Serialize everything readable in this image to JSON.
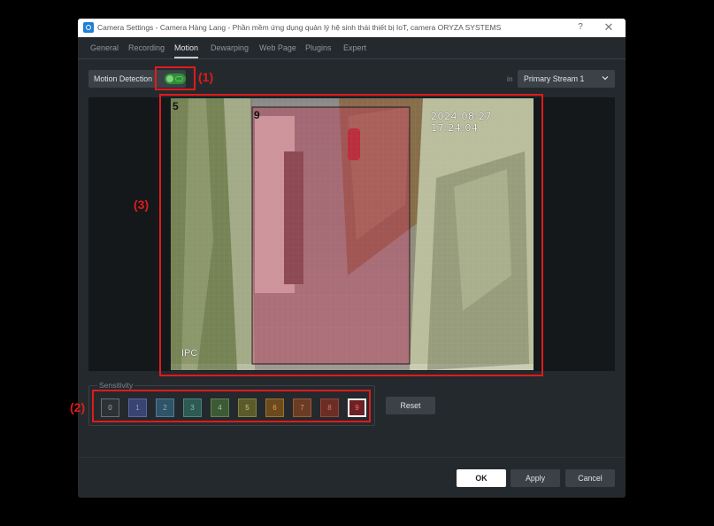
{
  "window": {
    "title": "Camera Settings - Camera Hàng Lang - Phần mềm ứng dụng quản lý hệ sinh thái thiết bị IoT, camera ORYZA SYSTEMS",
    "help_glyph": "?",
    "close_glyph": "✕"
  },
  "tabs": [
    {
      "label": "General",
      "active": false
    },
    {
      "label": "Recording",
      "active": false
    },
    {
      "label": "Motion",
      "active": true
    },
    {
      "label": "Dewarping",
      "active": false
    },
    {
      "label": "Web Page",
      "active": false
    },
    {
      "label": "Plugins",
      "active": false
    },
    {
      "label": "Expert",
      "active": false
    }
  ],
  "motion": {
    "label": "Motion Detection",
    "enabled": true,
    "stream_prefix": "in",
    "stream_value": "Primary Stream 1"
  },
  "video": {
    "timestamp": "2024-08-27 17:24:04",
    "osd_label": "IPC",
    "region_label_left": "5",
    "region_label_center": "9"
  },
  "sensitivity": {
    "legend": "Sensitivity",
    "levels": [
      {
        "label": "0",
        "bg": "#2c3236",
        "border": "#687076",
        "color": "#a9b0b5"
      },
      {
        "label": "1",
        "bg": "#3a4470",
        "border": "#5a66a0",
        "color": "#8f9ad0"
      },
      {
        "label": "2",
        "bg": "#2f5468",
        "border": "#4f7c95",
        "color": "#7fb0c8"
      },
      {
        "label": "3",
        "bg": "#2d5a52",
        "border": "#4a857a",
        "color": "#7cc0b0"
      },
      {
        "label": "4",
        "bg": "#3d5a36",
        "border": "#5e8252",
        "color": "#9cc88c"
      },
      {
        "label": "5",
        "bg": "#5a5a2a",
        "border": "#85853e",
        "color": "#cfcf73"
      },
      {
        "label": "6",
        "bg": "#6b4a1e",
        "border": "#a0702c",
        "color": "#e8a048"
      },
      {
        "label": "7",
        "bg": "#6a3c24",
        "border": "#9a5a38",
        "color": "#e08c5c"
      },
      {
        "label": "8",
        "bg": "#6a2e26",
        "border": "#984438",
        "color": "#e07264"
      },
      {
        "label": "9",
        "bg": "#6b2226",
        "border": "#ffffff",
        "color": "#ff6a6a"
      }
    ],
    "selected": "9",
    "reset_label": "Reset"
  },
  "footer": {
    "ok_label": "OK",
    "apply_label": "Apply",
    "cancel_label": "Cancel"
  },
  "annotations": {
    "label_1": "(1)",
    "label_2": "(2)",
    "label_3": "(3)",
    "color": "#e01b1b"
  }
}
